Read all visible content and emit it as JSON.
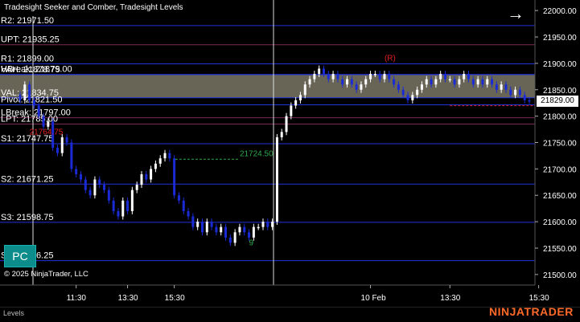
{
  "title": "Tradesight Seeker and Comber, Tradesight Levels",
  "copyright": "© 2025 NinjaTrader, LLC",
  "pc_button": "PC",
  "arrow_glyph": "→",
  "status_tab": "Levels",
  "brand": "NINJATRADER",
  "current_price": "21829.00",
  "colors": {
    "background": "#000000",
    "candle_up": "#ffffff",
    "candle_down": "#1a2bd6",
    "level_line": "#2232d8",
    "value_area": "#7a7766",
    "accent": "#ff6a2a",
    "signal_green": "#2ea84a",
    "signal_red": "#e02020"
  },
  "levels": [
    {
      "label": "R2: 21971.50",
      "price": 21971.5,
      "color": "#2232d8"
    },
    {
      "label": "UPT: 21935.25",
      "price": 21935.25,
      "color": "#7a2a55"
    },
    {
      "label": "R1: 21899.00",
      "price": 21899.0,
      "color": "#2232d8"
    },
    {
      "label": "VAH: 21878.75",
      "price": 21878.75,
      "color": "#2232d8"
    },
    {
      "label": "HBreak: 21879.00",
      "price": 21879.0,
      "color": "#2232d8"
    },
    {
      "label": "VAL: 21834.75",
      "price": 21834.75,
      "color": "#2232d8"
    },
    {
      "label": "Pivot: 21821.50",
      "price": 21821.5,
      "color": "#2232d8"
    },
    {
      "label": "LBreak: 21797.00",
      "price": 21797.0,
      "color": "#7a2a55"
    },
    {
      "label": "LPT: 21785.00",
      "price": 21785.0,
      "color": "#7a2a55"
    },
    {
      "label": "S1: 21747.75",
      "price": 21747.75,
      "color": "#2232d8"
    },
    {
      "label": "S2: 21671.25",
      "price": 21671.25,
      "color": "#2232d8"
    },
    {
      "label": "S3: 21598.75",
      "price": 21598.75,
      "color": "#2232d8"
    },
    {
      "label": "S4: 21526.25",
      "price": 21526.25,
      "color": "#2232d8"
    }
  ],
  "annotations": [
    {
      "text": "21724.50",
      "price": 21724.5,
      "bar": 47,
      "color": "#2ea84a"
    },
    {
      "text": "21829.00",
      "price": 21825,
      "bar": 120,
      "color": "#e02020"
    },
    {
      "text": "21764.75",
      "price": 21765,
      "bar": 2,
      "color": "#e02020"
    },
    {
      "text": "(R)",
      "price": 21905,
      "bar": 78,
      "color": "#e02020"
    },
    {
      "text": "9",
      "price": 21555,
      "bar": 49,
      "color": "#2ea84a"
    }
  ],
  "chart_data": {
    "type": "candlestick",
    "title": "Tradesight Seeker and Comber, Tradesight Levels",
    "ylim": [
      21480,
      22020
    ],
    "y_ticks": [
      "22000.00",
      "21950.00",
      "21900.00",
      "21850.00",
      "21800.00",
      "21750.00",
      "21700.00",
      "21650.00",
      "21600.00",
      "21550.00",
      "21500.00"
    ],
    "x_ticks": [
      {
        "label": "11:30",
        "bar": 12
      },
      {
        "label": "13:30",
        "bar": 23
      },
      {
        "label": "15:30",
        "bar": 33
      },
      {
        "label": "10 Feb",
        "bar": 75
      },
      {
        "label": "13:30",
        "bar": 92
      },
      {
        "label": "15:30",
        "bar": 111
      }
    ],
    "session_break_bar": 36,
    "closes": [
      21830,
      21860,
      21830,
      21820,
      21800,
      21780,
      21790,
      21740,
      21730,
      21760,
      21750,
      21700,
      21690,
      21680,
      21660,
      21650,
      21680,
      21670,
      21660,
      21640,
      21620,
      21610,
      21640,
      21620,
      21660,
      21670,
      21690,
      21680,
      21700,
      21710,
      21720,
      21730,
      21720,
      21650,
      21640,
      21620,
      21610,
      21590,
      21600,
      21580,
      21600,
      21590,
      21580,
      21590,
      21570,
      21560,
      21580,
      21590,
      21580,
      21570,
      21590,
      21590,
      21600,
      21590,
      21600,
      21760,
      21770,
      21800,
      21820,
      21830,
      21840,
      21860,
      21870,
      21880,
      21890,
      21880,
      21870,
      21880,
      21870,
      21860,
      21870,
      21860,
      21850,
      21860,
      21870,
      21880,
      21880,
      21870,
      21880,
      21870,
      21860,
      21850,
      21840,
      21830,
      21840,
      21850,
      21860,
      21870,
      21860,
      21870,
      21880,
      21870,
      21870,
      21860,
      21870,
      21880,
      21870,
      21860,
      21870,
      21860,
      21870,
      21860,
      21850,
      21860,
      21850,
      21840,
      21850,
      21840,
      21830,
      21829
    ]
  }
}
